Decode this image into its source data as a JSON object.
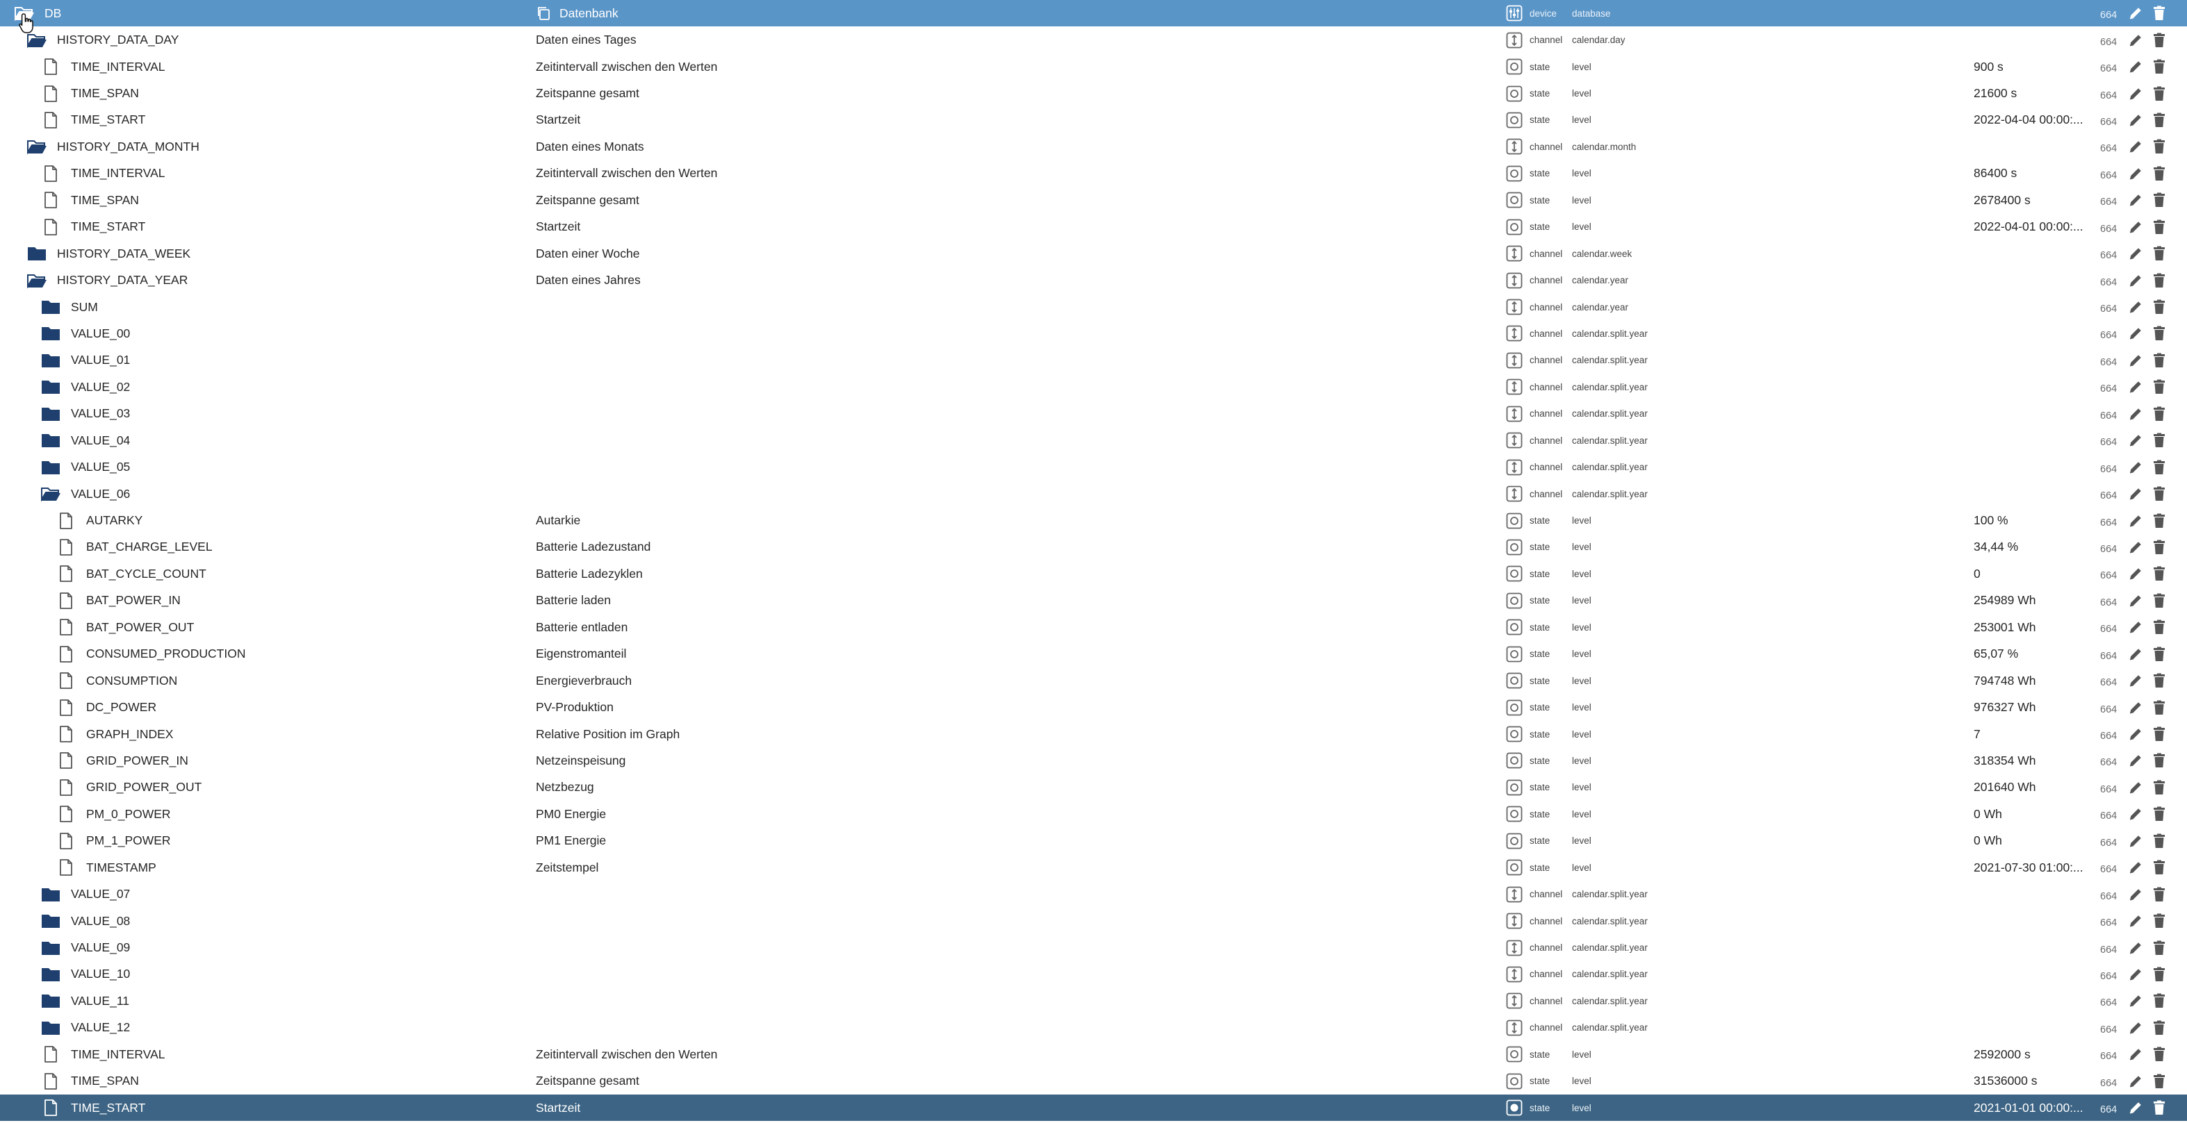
{
  "rows": [
    {
      "name": "DB",
      "level": 0,
      "icon": "folder-open",
      "desc": "Datenbank",
      "type": "device",
      "role": "database",
      "value": "",
      "acl": "664",
      "variant": "top"
    },
    {
      "name": "HISTORY_DATA_DAY",
      "level": 1,
      "icon": "folder-open",
      "desc": "Daten eines Tages",
      "type": "channel",
      "role": "calendar.day",
      "value": "",
      "acl": "664"
    },
    {
      "name": "TIME_INTERVAL",
      "level": 2,
      "icon": "file",
      "desc": "Zeitintervall zwischen den Werten",
      "type": "state",
      "role": "level",
      "value": "900 s",
      "acl": "664"
    },
    {
      "name": "TIME_SPAN",
      "level": 2,
      "icon": "file",
      "desc": "Zeitspanne gesamt",
      "type": "state",
      "role": "level",
      "value": "21600 s",
      "acl": "664"
    },
    {
      "name": "TIME_START",
      "level": 2,
      "icon": "file",
      "desc": "Startzeit",
      "type": "state",
      "role": "level",
      "value": "2022-04-04 00:00:...",
      "acl": "664"
    },
    {
      "name": "HISTORY_DATA_MONTH",
      "level": 1,
      "icon": "folder-open",
      "desc": "Daten eines Monats",
      "type": "channel",
      "role": "calendar.month",
      "value": "",
      "acl": "664"
    },
    {
      "name": "TIME_INTERVAL",
      "level": 2,
      "icon": "file",
      "desc": "Zeitintervall zwischen den Werten",
      "type": "state",
      "role": "level",
      "value": "86400 s",
      "acl": "664"
    },
    {
      "name": "TIME_SPAN",
      "level": 2,
      "icon": "file",
      "desc": "Zeitspanne gesamt",
      "type": "state",
      "role": "level",
      "value": "2678400 s",
      "acl": "664"
    },
    {
      "name": "TIME_START",
      "level": 2,
      "icon": "file",
      "desc": "Startzeit",
      "type": "state",
      "role": "level",
      "value": "2022-04-01 00:00:...",
      "acl": "664"
    },
    {
      "name": "HISTORY_DATA_WEEK",
      "level": 1,
      "icon": "folder",
      "desc": "Daten einer Woche",
      "type": "channel",
      "role": "calendar.week",
      "value": "",
      "acl": "664"
    },
    {
      "name": "HISTORY_DATA_YEAR",
      "level": 1,
      "icon": "folder-open",
      "desc": "Daten eines Jahres",
      "type": "channel",
      "role": "calendar.year",
      "value": "",
      "acl": "664"
    },
    {
      "name": "SUM",
      "level": 2,
      "icon": "folder",
      "desc": "",
      "type": "channel",
      "role": "calendar.year",
      "value": "",
      "acl": "664"
    },
    {
      "name": "VALUE_00",
      "level": 2,
      "icon": "folder",
      "desc": "",
      "type": "channel",
      "role": "calendar.split.year",
      "value": "",
      "acl": "664"
    },
    {
      "name": "VALUE_01",
      "level": 2,
      "icon": "folder",
      "desc": "",
      "type": "channel",
      "role": "calendar.split.year",
      "value": "",
      "acl": "664"
    },
    {
      "name": "VALUE_02",
      "level": 2,
      "icon": "folder",
      "desc": "",
      "type": "channel",
      "role": "calendar.split.year",
      "value": "",
      "acl": "664"
    },
    {
      "name": "VALUE_03",
      "level": 2,
      "icon": "folder",
      "desc": "",
      "type": "channel",
      "role": "calendar.split.year",
      "value": "",
      "acl": "664"
    },
    {
      "name": "VALUE_04",
      "level": 2,
      "icon": "folder",
      "desc": "",
      "type": "channel",
      "role": "calendar.split.year",
      "value": "",
      "acl": "664"
    },
    {
      "name": "VALUE_05",
      "level": 2,
      "icon": "folder",
      "desc": "",
      "type": "channel",
      "role": "calendar.split.year",
      "value": "",
      "acl": "664"
    },
    {
      "name": "VALUE_06",
      "level": 2,
      "icon": "folder-open",
      "desc": "",
      "type": "channel",
      "role": "calendar.split.year",
      "value": "",
      "acl": "664"
    },
    {
      "name": "AUTARKY",
      "level": 3,
      "icon": "file",
      "desc": "Autarkie",
      "type": "state",
      "role": "level",
      "value": "100 %",
      "acl": "664"
    },
    {
      "name": "BAT_CHARGE_LEVEL",
      "level": 3,
      "icon": "file",
      "desc": "Batterie Ladezustand",
      "type": "state",
      "role": "level",
      "value": "34,44 %",
      "acl": "664"
    },
    {
      "name": "BAT_CYCLE_COUNT",
      "level": 3,
      "icon": "file",
      "desc": "Batterie Ladezyklen",
      "type": "state",
      "role": "level",
      "value": "0",
      "acl": "664"
    },
    {
      "name": "BAT_POWER_IN",
      "level": 3,
      "icon": "file",
      "desc": "Batterie laden",
      "type": "state",
      "role": "level",
      "value": "254989 Wh",
      "acl": "664"
    },
    {
      "name": "BAT_POWER_OUT",
      "level": 3,
      "icon": "file",
      "desc": "Batterie entladen",
      "type": "state",
      "role": "level",
      "value": "253001 Wh",
      "acl": "664"
    },
    {
      "name": "CONSUMED_PRODUCTION",
      "level": 3,
      "icon": "file",
      "desc": "Eigenstromanteil",
      "type": "state",
      "role": "level",
      "value": "65,07 %",
      "acl": "664"
    },
    {
      "name": "CONSUMPTION",
      "level": 3,
      "icon": "file",
      "desc": "Energieverbrauch",
      "type": "state",
      "role": "level",
      "value": "794748 Wh",
      "acl": "664"
    },
    {
      "name": "DC_POWER",
      "level": 3,
      "icon": "file",
      "desc": "PV-Produktion",
      "type": "state",
      "role": "level",
      "value": "976327 Wh",
      "acl": "664"
    },
    {
      "name": "GRAPH_INDEX",
      "level": 3,
      "icon": "file",
      "desc": "Relative Position im Graph",
      "type": "state",
      "role": "level",
      "value": "7",
      "acl": "664"
    },
    {
      "name": "GRID_POWER_IN",
      "level": 3,
      "icon": "file",
      "desc": "Netzeinspeisung",
      "type": "state",
      "role": "level",
      "value": "318354 Wh",
      "acl": "664"
    },
    {
      "name": "GRID_POWER_OUT",
      "level": 3,
      "icon": "file",
      "desc": "Netzbezug",
      "type": "state",
      "role": "level",
      "value": "201640 Wh",
      "acl": "664"
    },
    {
      "name": "PM_0_POWER",
      "level": 3,
      "icon": "file",
      "desc": "PM0 Energie",
      "type": "state",
      "role": "level",
      "value": "0 Wh",
      "acl": "664"
    },
    {
      "name": "PM_1_POWER",
      "level": 3,
      "icon": "file",
      "desc": "PM1 Energie",
      "type": "state",
      "role": "level",
      "value": "0 Wh",
      "acl": "664"
    },
    {
      "name": "TIMESTAMP",
      "level": 3,
      "icon": "file",
      "desc": "Zeitstempel",
      "type": "state",
      "role": "level",
      "value": "2021-07-30 01:00:...",
      "acl": "664"
    },
    {
      "name": "VALUE_07",
      "level": 2,
      "icon": "folder",
      "desc": "",
      "type": "channel",
      "role": "calendar.split.year",
      "value": "",
      "acl": "664"
    },
    {
      "name": "VALUE_08",
      "level": 2,
      "icon": "folder",
      "desc": "",
      "type": "channel",
      "role": "calendar.split.year",
      "value": "",
      "acl": "664"
    },
    {
      "name": "VALUE_09",
      "level": 2,
      "icon": "folder",
      "desc": "",
      "type": "channel",
      "role": "calendar.split.year",
      "value": "",
      "acl": "664"
    },
    {
      "name": "VALUE_10",
      "level": 2,
      "icon": "folder",
      "desc": "",
      "type": "channel",
      "role": "calendar.split.year",
      "value": "",
      "acl": "664"
    },
    {
      "name": "VALUE_11",
      "level": 2,
      "icon": "folder",
      "desc": "",
      "type": "channel",
      "role": "calendar.split.year",
      "value": "",
      "acl": "664"
    },
    {
      "name": "VALUE_12",
      "level": 2,
      "icon": "folder",
      "desc": "",
      "type": "channel",
      "role": "calendar.split.year",
      "value": "",
      "acl": "664"
    },
    {
      "name": "TIME_INTERVAL",
      "level": 2,
      "icon": "file",
      "desc": "Zeitintervall zwischen den Werten",
      "type": "state",
      "role": "level",
      "value": "2592000 s",
      "acl": "664"
    },
    {
      "name": "TIME_SPAN",
      "level": 2,
      "icon": "file",
      "desc": "Zeitspanne gesamt",
      "type": "state",
      "role": "level",
      "value": "31536000 s",
      "acl": "664"
    },
    {
      "name": "TIME_START",
      "level": 2,
      "icon": "file",
      "desc": "Startzeit",
      "type": "state",
      "role": "level",
      "value": "2021-01-01 00:00:...",
      "acl": "664",
      "variant": "selected"
    }
  ],
  "colors": {
    "folder": "#1f3f6e",
    "top_bar": "#5a95c8",
    "selected_bar": "#3d6484",
    "icon_gray": "#666666"
  }
}
